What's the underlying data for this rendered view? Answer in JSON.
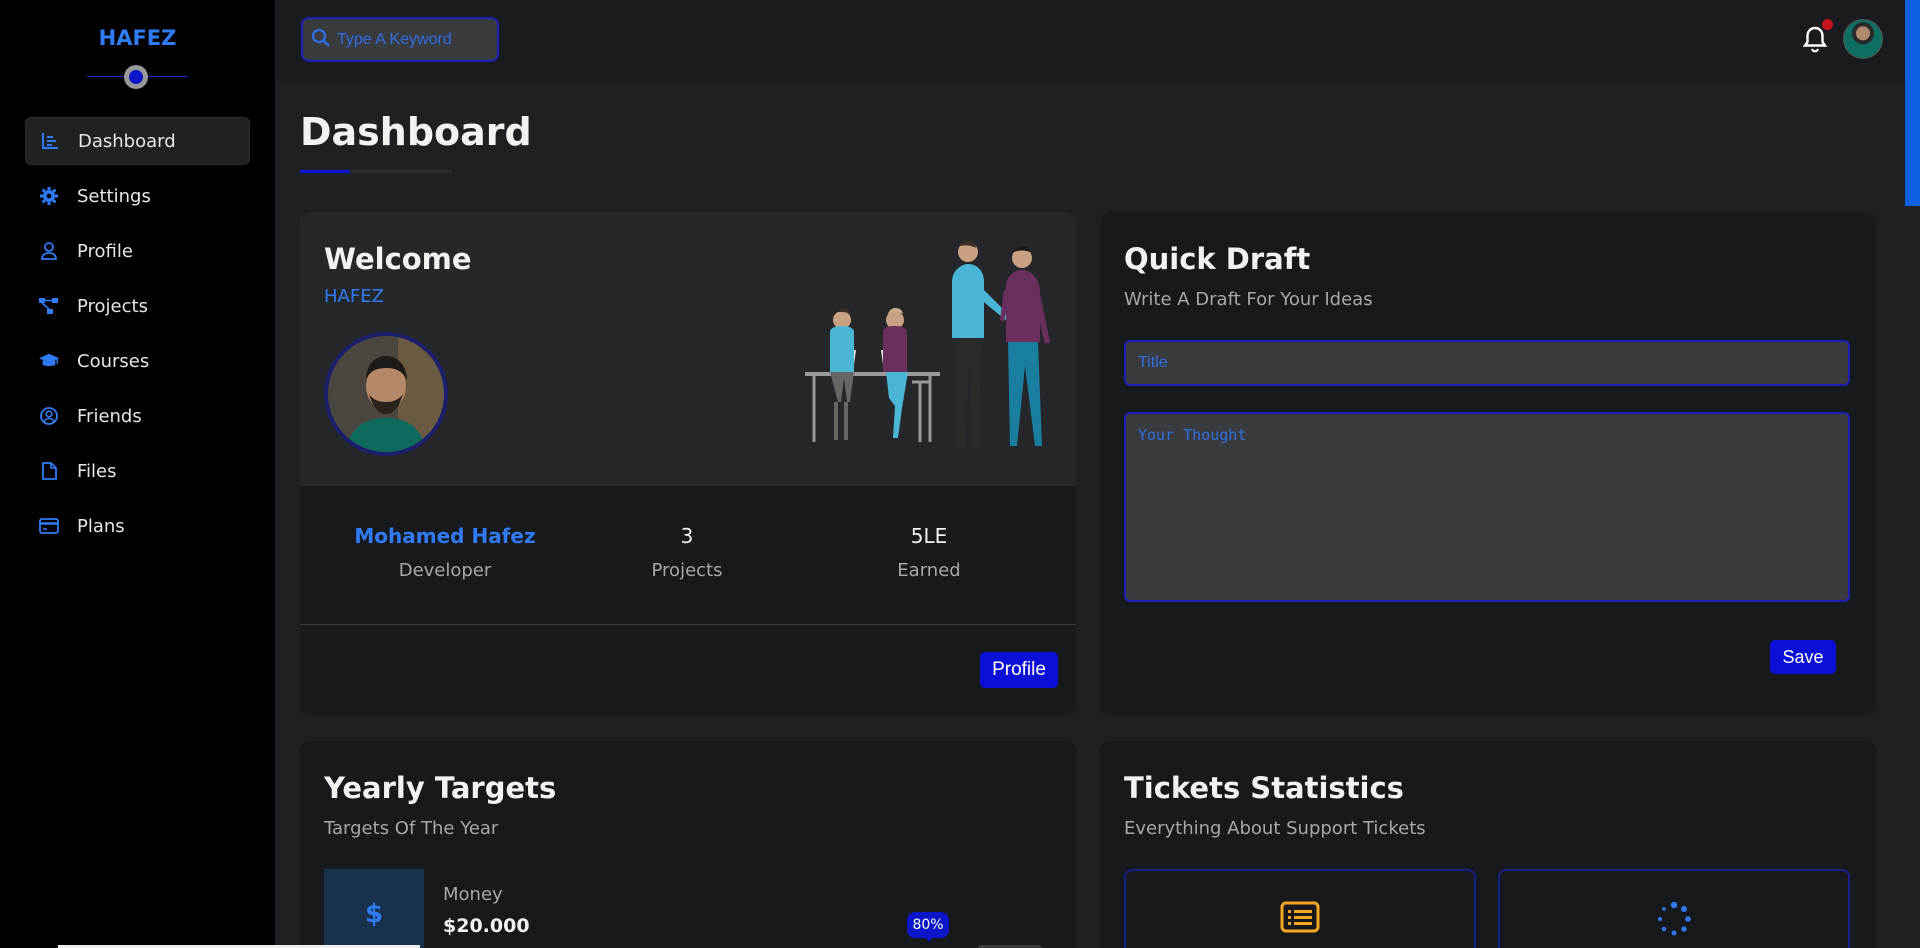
{
  "sidebar": {
    "brand": "HAFEZ",
    "items": [
      {
        "label": "Dashboard",
        "icon": "chart-icon"
      },
      {
        "label": "Settings",
        "icon": "gear-icon"
      },
      {
        "label": "Profile",
        "icon": "user-icon"
      },
      {
        "label": "Projects",
        "icon": "diagram-icon"
      },
      {
        "label": "Courses",
        "icon": "graduation-cap-icon"
      },
      {
        "label": "Friends",
        "icon": "user-circle-icon"
      },
      {
        "label": "Files",
        "icon": "file-icon"
      },
      {
        "label": "Plans",
        "icon": "credit-card-icon"
      }
    ],
    "active": "Dashboard"
  },
  "header": {
    "search_placeholder": "Type A Keyword"
  },
  "page": {
    "title": "Dashboard"
  },
  "welcome": {
    "title": "Welcome",
    "name": "HAFEZ",
    "stats": [
      {
        "value": "Mohamed Hafez",
        "label": "Developer"
      },
      {
        "value": "3",
        "label": "Projects"
      },
      {
        "value": "5LE",
        "label": "Earned"
      }
    ],
    "button_label": "Profile"
  },
  "draft": {
    "title": "Quick Draft",
    "subtitle": "Write A Draft For Your Ideas",
    "title_placeholder": "Title",
    "thought_placeholder": "Your Thought",
    "save_label": "Save"
  },
  "targets": {
    "title": "Yearly Targets",
    "subtitle": "Targets Of The Year",
    "items": [
      {
        "name": "Money",
        "amount": "$20.000",
        "progress_label": "80%",
        "progress": 0.8
      }
    ]
  },
  "tickets": {
    "title": "Tickets Statistics",
    "subtitle": "Everything About Support Tickets"
  },
  "colors": {
    "accent": "#2f7cf6",
    "button": "#0b0fd8",
    "sidebar_bg": "#000000",
    "card_bg": "#18191c"
  }
}
